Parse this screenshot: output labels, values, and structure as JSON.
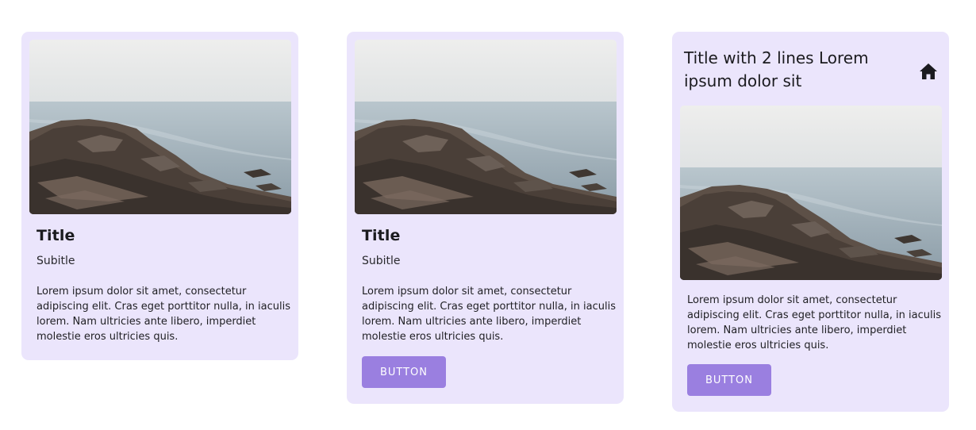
{
  "cards": [
    {
      "title": "Title",
      "subtitle": "Subitle",
      "body": "Lorem ipsum dolor sit amet, consectetur adipiscing elit. Cras eget porttitor nulla, in iaculis lorem. Nam ultricies ante libero, imperdiet molestie eros ultricies quis."
    },
    {
      "title": "Title",
      "subtitle": "Subitle",
      "body": "Lorem ipsum dolor sit amet, consectetur adipiscing elit. Cras eget porttitor nulla, in iaculis lorem. Nam ultricies ante libero, imperdiet molestie eros ultricies quis.",
      "button_label": "BUTTON"
    },
    {
      "title": "Title with 2 lines Lorem ipsum dolor sit",
      "icon": "home-icon",
      "body": "Lorem ipsum dolor sit amet, consectetur adipiscing elit. Cras eget porttitor nulla, in iaculis lorem. Nam ultricies ante libero, imperdiet molestie eros ultricies quis.",
      "button_label": "BUTTON"
    }
  ],
  "colors": {
    "card_background": "#ebe5fc",
    "button_background": "#9a7fe0",
    "button_text": "#ffffff"
  }
}
